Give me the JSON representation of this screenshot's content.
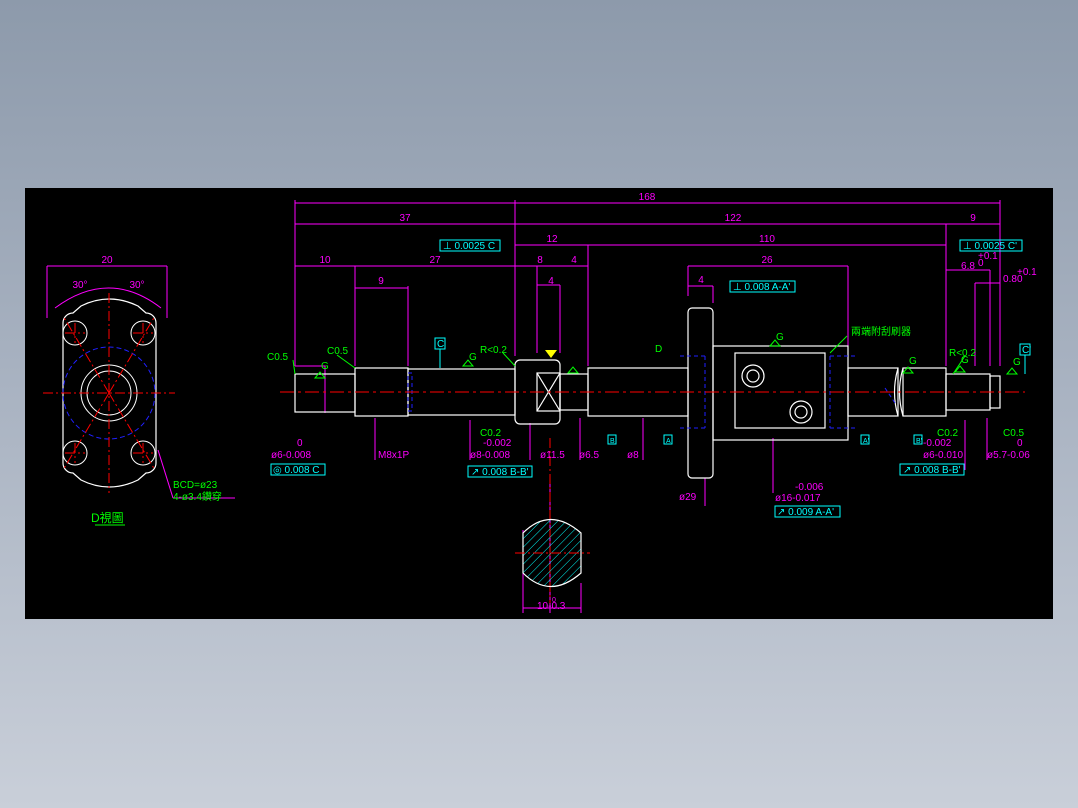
{
  "drawing": {
    "dims": {
      "overall": "168",
      "d37": "37",
      "d122": "122",
      "d9": "9",
      "d12": "12",
      "d110": "110",
      "d10": "10",
      "d27": "27",
      "d9b": "9",
      "d8": "8",
      "d4a": "4",
      "d4b": "4",
      "d4c": "4",
      "d26": "26",
      "d68": "6.8",
      "d68_tol": "+0.1\n0",
      "d08": "0.8",
      "d08_tol": "+0.1\n0",
      "flange_width": "20",
      "angle_left": "30°",
      "angle_right": "30°"
    },
    "frames": {
      "perp_left": "⊥ 0.0025 C",
      "perp_right": "⊥ 0.0025 C'",
      "perp_nut": "⊥ 0.008 A-A'",
      "concentric": "◎ 0.008 C",
      "runout_bb": "↗ 0.008 B-B'",
      "runout_bb_right": "↗ 0.008 B-B'",
      "runout_aa": "↗ 0.009 A-A'"
    },
    "labels": {
      "c05_left": "C0.5",
      "c05_shaft": "C0.5",
      "c05_right": "C0.5",
      "r02_left": "R<0.2",
      "r02_right": "R<0.2",
      "c02_left": "C0.2",
      "c02_right": "C0.2",
      "datum_c": "C",
      "datum_c2": "C'",
      "datum_b": "B",
      "datum_a": "A",
      "datum_a2": "A'",
      "datum_b2": "B'",
      "view_arrow": "D",
      "wiper_note": "兩端附刮刷器",
      "bcd": "BCD=ø23",
      "holes": "4-ø3.4鑽穿",
      "view_title": "D視圖",
      "g": "G"
    },
    "callouts": {
      "phi6_tol_top": "0",
      "phi6": "ø6-0.008",
      "thread": "M8x1P",
      "phi8_tol_top": "-0.002",
      "phi8": "ø8-0.008",
      "phi115": "ø11.5",
      "phi65": "ø6.5",
      "phi8b": "ø8",
      "phi29": "ø29",
      "phi16_tol_top": "-0.006",
      "phi16": "ø16-0.017",
      "phi6r_tol_top": "-0.002",
      "phi6r": "ø6-0.010",
      "phi57_tol_top": "0",
      "phi57": "ø5.7-0.06",
      "section_dim_tol": "0",
      "section_dim": "10-0.3"
    },
    "colors": {
      "background": "#000000",
      "outline": "#ffffff",
      "dimension": "#ff00ff",
      "note": "#00ff00",
      "frame": "#00ffff",
      "center": "#ff0000",
      "hidden": "#2020ff",
      "yellow": "#ffff00"
    }
  }
}
